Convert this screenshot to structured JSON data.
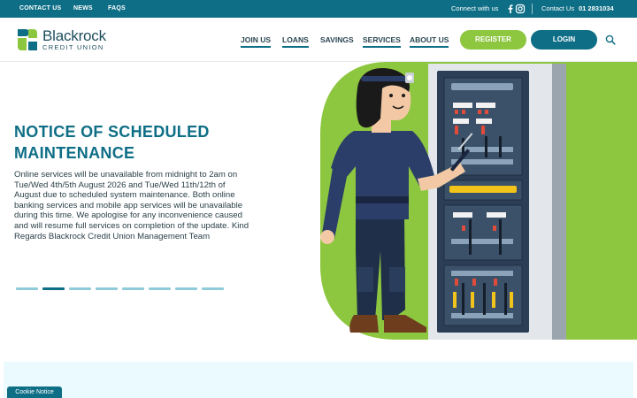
{
  "topbar": {
    "links": [
      "CONTACT US",
      "NEWS",
      "FAQS"
    ],
    "connect_label": "Connect with us",
    "social_icons": [
      "facebook-icon",
      "instagram-icon"
    ],
    "contact_label": "Contact Us",
    "phone": "01 2831034"
  },
  "header": {
    "logo": {
      "name": "Blackrock",
      "subtitle": "CREDIT UNION",
      "colors": [
        "#0e6e86",
        "#8dc63f"
      ]
    },
    "nav": [
      "JOIN US",
      "LOANS",
      "SAVINGS",
      "SERVICES",
      "ABOUT US"
    ],
    "register_label": "REGISTER",
    "login_label": "LOGIN",
    "search_icon": "search-icon"
  },
  "hero": {
    "title": "NOTICE OF SCHEDULED MAINTENANCE",
    "body": "Online services will be unavailable from midnight to 2am on Tue/Wed 4th/5th August 2026 and Tue/Wed 11th/12th of August due to scheduled system maintenance. Both online banking services and mobile app services will be unavailable during this time. We apologise for any inconvenience caused and will resume full services on completion of the update. Kind Regards Blackrock Credit Union Management Team",
    "slides_total": 8,
    "active_slide": 2
  },
  "cookie_notice_label": "Cookie Notice",
  "colors": {
    "primary": "#0e6e86",
    "accent": "#8dc63f",
    "band": "#eafaff"
  }
}
